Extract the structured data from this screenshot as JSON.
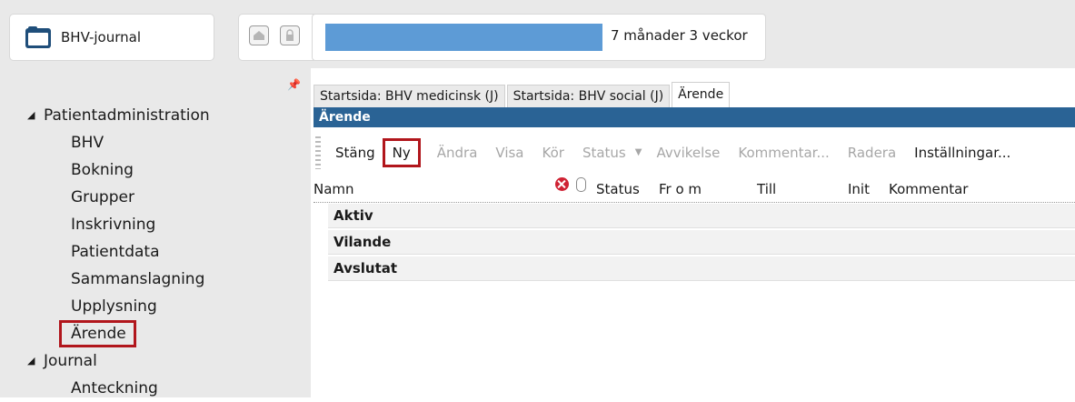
{
  "header": {
    "journal_label": "BHV-journal",
    "patient_age": "7 månader 3 veckor"
  },
  "sidebar": {
    "groups": [
      {
        "label": "Patientadministration",
        "items": [
          "BHV",
          "Bokning",
          "Grupper",
          "Inskrivning",
          "Patientdata",
          "Sammanslagning",
          "Upplysning",
          "Ärende"
        ]
      },
      {
        "label": "Journal",
        "items": [
          "Anteckning"
        ]
      }
    ],
    "selected_item": "Ärende"
  },
  "tabs": [
    "Startsida: BHV medicinsk (J)",
    "Startsida: BHV social (J)",
    "Ärende"
  ],
  "active_tab": "Ärende",
  "section_title": "Ärende",
  "toolbar": {
    "close": "Stäng",
    "new": "Ny",
    "edit": "Ändra",
    "view": "Visa",
    "run": "Kör",
    "status": "Status",
    "deviation": "Avvikelse",
    "comment": "Kommentar...",
    "delete": "Radera",
    "settings": "Inställningar..."
  },
  "columns": {
    "name": "Namn",
    "status": "Status",
    "from": "Fr o m",
    "to": "Till",
    "init": "Init",
    "comment": "Kommentar"
  },
  "rows": [
    "Aktiv",
    "Vilande",
    "Avslutat"
  ],
  "colors": {
    "section_header": "#2a6395",
    "highlight": "#b1161c",
    "redaction": "#5d9bd6"
  }
}
